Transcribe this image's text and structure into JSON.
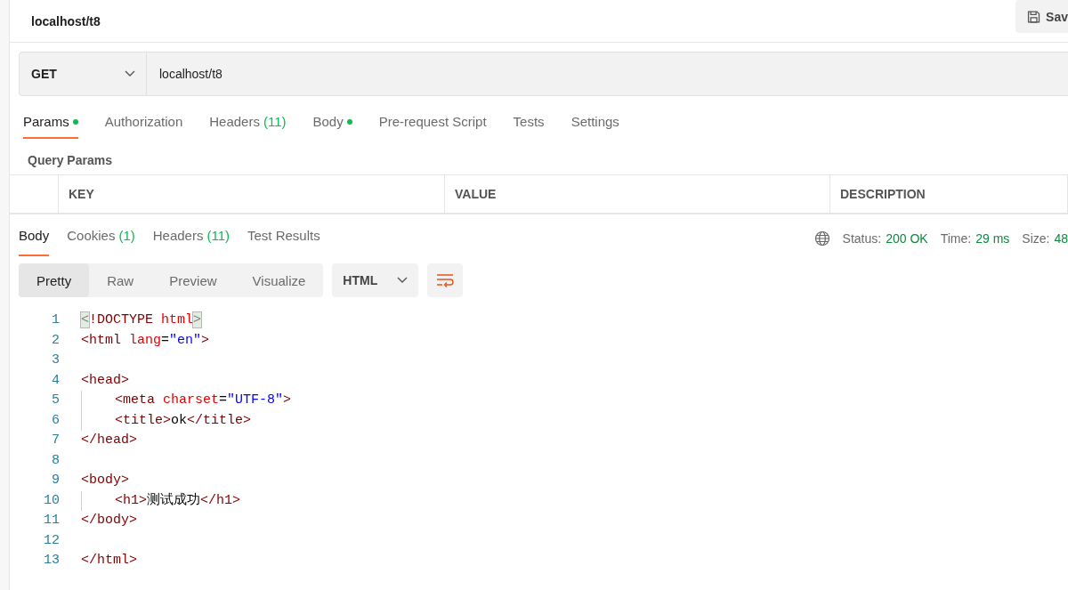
{
  "header": {
    "title": "localhost/t8",
    "save_label": "Sav"
  },
  "request": {
    "method": "GET",
    "url": "localhost/t8"
  },
  "request_tabs": [
    {
      "label": "Params",
      "dot": true,
      "selected": true
    },
    {
      "label": "Authorization",
      "dot": false,
      "selected": false
    },
    {
      "label": "Headers",
      "count": "(11)",
      "dot": false,
      "selected": false
    },
    {
      "label": "Body",
      "dot": true,
      "selected": false
    },
    {
      "label": "Pre-request Script",
      "dot": false,
      "selected": false
    },
    {
      "label": "Tests",
      "dot": false,
      "selected": false
    },
    {
      "label": "Settings",
      "dot": false,
      "selected": false
    }
  ],
  "query_params": {
    "title": "Query Params",
    "columns": [
      "KEY",
      "VALUE",
      "DESCRIPTION"
    ]
  },
  "response_tabs": [
    {
      "label": "Body",
      "selected": true
    },
    {
      "label": "Cookies",
      "count": "(1)",
      "selected": false
    },
    {
      "label": "Headers",
      "count": "(11)",
      "selected": false
    },
    {
      "label": "Test Results",
      "selected": false
    }
  ],
  "status": [
    {
      "label": "Status:",
      "value": "200 OK"
    },
    {
      "label": "Time:",
      "value": "29 ms"
    },
    {
      "label": "Size:",
      "value": "48"
    }
  ],
  "view_modes": [
    {
      "label": "Pretty",
      "selected": true
    },
    {
      "label": "Raw",
      "selected": false
    },
    {
      "label": "Preview",
      "selected": false
    },
    {
      "label": "Visualize",
      "selected": false
    }
  ],
  "format": "HTML",
  "code": [
    {
      "number": "1",
      "tokens": [
        {
          "kind": "match",
          "text": "<"
        },
        {
          "kind": "doctype",
          "text": "!DOCTYPE "
        },
        {
          "kind": "attr",
          "text": "html"
        },
        {
          "kind": "match",
          "text": ">"
        }
      ]
    },
    {
      "number": "2",
      "tokens": [
        {
          "kind": "tag",
          "text": "<html "
        },
        {
          "kind": "attr",
          "text": "lang"
        },
        {
          "kind": "plain",
          "text": "="
        },
        {
          "kind": "string",
          "text": "\"en\""
        },
        {
          "kind": "tag",
          "text": ">"
        }
      ]
    },
    {
      "number": "3"
    },
    {
      "number": "4",
      "tokens": [
        {
          "kind": "tag",
          "text": "<head>"
        }
      ],
      "children": [
        {
          "number": "5",
          "tokens": [
            {
              "kind": "tag",
              "text": "<meta "
            },
            {
              "kind": "attr",
              "text": "charset"
            },
            {
              "kind": "plain",
              "text": "="
            },
            {
              "kind": "string",
              "text": "\"UTF-8\""
            },
            {
              "kind": "tag",
              "text": ">"
            }
          ]
        },
        {
          "number": "6",
          "tokens": [
            {
              "kind": "tag",
              "text": "<title>"
            },
            {
              "kind": "plain",
              "text": "ok"
            },
            {
              "kind": "tag",
              "text": "</title>"
            }
          ]
        }
      ]
    },
    {
      "number": "7",
      "tokens": [
        {
          "kind": "tag",
          "text": "</head>"
        }
      ]
    },
    {
      "number": "8"
    },
    {
      "number": "9",
      "tokens": [
        {
          "kind": "tag",
          "text": "<body>"
        }
      ],
      "children": [
        {
          "number": "10",
          "tokens": [
            {
              "kind": "tag",
              "text": "<h1>"
            },
            {
              "kind": "plain",
              "text": "测试成功"
            },
            {
              "kind": "tag",
              "text": "</h1>"
            }
          ]
        }
      ]
    },
    {
      "number": "11",
      "tokens": [
        {
          "kind": "tag",
          "text": "</body>"
        }
      ]
    },
    {
      "number": "12"
    },
    {
      "number": "13",
      "tokens": [
        {
          "kind": "tag",
          "text": "</html>"
        }
      ]
    }
  ]
}
